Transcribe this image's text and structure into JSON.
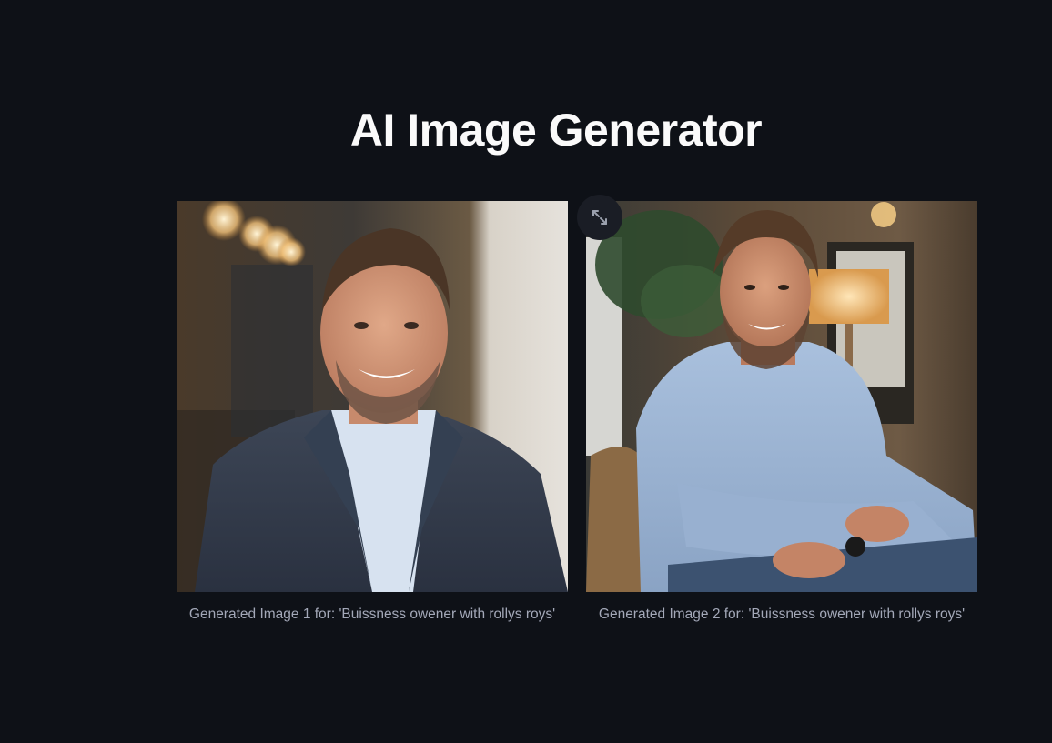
{
  "header": {
    "title": "AI Image Generator"
  },
  "gallery": {
    "expand_icon": "fullscreen-icon",
    "images": [
      {
        "caption": "Generated Image 1 for: 'Buissness owener with rollys roys'",
        "alt": "Generated Image 1"
      },
      {
        "caption": "Generated Image 2 for: 'Buissness owener with rollys roys'",
        "alt": "Generated Image 2"
      }
    ]
  },
  "colors": {
    "background": "#0e1117",
    "title": "#fafafa",
    "caption": "#a3a8b8"
  }
}
